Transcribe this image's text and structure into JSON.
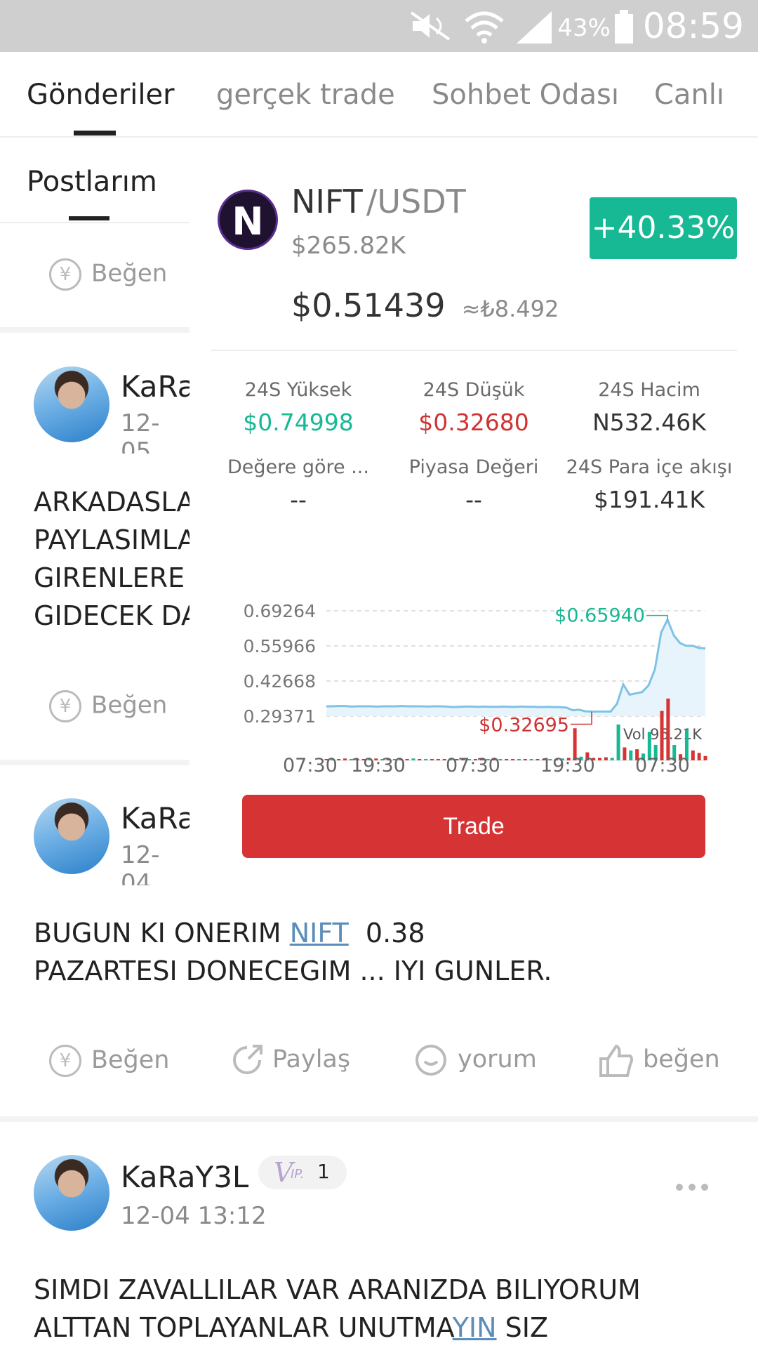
{
  "status_bar": {
    "battery": "43%",
    "time": "08:59"
  },
  "tabs": [
    {
      "label": "Gönderiler"
    },
    {
      "label": "gerçek trade"
    },
    {
      "label": "Sohbet Odası"
    },
    {
      "label": "Canlı"
    }
  ],
  "feed": {
    "sub_tab": "Postlarım",
    "like_label": "Beğen",
    "posts": [
      {
        "user": "KaRa",
        "date": "12-05",
        "text_lines": [
          "ARKADASLA",
          "PAYLASIMLA",
          "GIRENLERE",
          "GIDECEK DA"
        ]
      },
      {
        "user": "KaRa",
        "date": "12-04",
        "text_pre": "BUGUN KI ONERIM ",
        "text_link": "NIFT",
        "text_post": "  0.38",
        "text_line2": "PAZARTESI DONECEGIM ... IYI GUNLER."
      },
      {
        "user": "KaRaY3L",
        "vip_label": "IP.",
        "vip_level": "1",
        "date": "12-04 13:12",
        "line1": "SIMDI ZAVALLILAR VAR ARANIZDA BILIYORUM",
        "line2_pre": "ALTTAN TOPLAYANLAR UNUTMA",
        "line2_link": "YIN",
        "line2_post": " SIZ"
      }
    ],
    "actions": {
      "begen": "Beğen",
      "paylas": "Paylaş",
      "yorum": "yorum",
      "begen2": "beğen"
    }
  },
  "card": {
    "logo_letter": "N",
    "base": "NIFT",
    "quote": "/USDT",
    "volume": "$265.82K",
    "change": "+40.33%",
    "price": "$0.51439",
    "approx": "≈₺8.492",
    "stats": [
      {
        "label": "24S Yüksek",
        "value": "$0.74998",
        "tone": "green"
      },
      {
        "label": "24S Düşük",
        "value": "$0.32680",
        "tone": "red"
      },
      {
        "label": "24S Hacim",
        "value": "N532.46K",
        "tone": ""
      },
      {
        "label": "Değere göre ...",
        "value": "--",
        "tone": ""
      },
      {
        "label": "Piyasa Değeri",
        "value": "--",
        "tone": ""
      },
      {
        "label": "24S Para içe akışı",
        "value": "$191.41K",
        "tone": ""
      }
    ],
    "trade_label": "Trade"
  },
  "chart_data": {
    "type": "line",
    "title": "",
    "y_ticks": [
      "0.69264",
      "0.55966",
      "0.42668",
      "0.29371"
    ],
    "x_ticks": [
      "07:30",
      "19:30",
      "07:30",
      "19:30",
      "07:30"
    ],
    "ylim": [
      0.29371,
      0.69264
    ],
    "high_label": "$0.65940",
    "low_label": "$0.32695",
    "vol_label": "Vol 96.21K",
    "grid": true,
    "series": [
      {
        "values": [
          0.331,
          0.331,
          0.332,
          0.332,
          0.33,
          0.331,
          0.331,
          0.331,
          0.33,
          0.331,
          0.331,
          0.331,
          0.332,
          0.331,
          0.331,
          0.331,
          0.33,
          0.331,
          0.331,
          0.33,
          0.328,
          0.329,
          0.33,
          0.33,
          0.329,
          0.33,
          0.329,
          0.329,
          0.33,
          0.329,
          0.329,
          0.33,
          0.329,
          0.329,
          0.328,
          0.329,
          0.328,
          0.328,
          0.326,
          0.316,
          0.318,
          0.312,
          0.311,
          0.311,
          0.311,
          0.311,
          0.34,
          0.414,
          0.375,
          0.38,
          0.385,
          0.41,
          0.47,
          0.61,
          0.659,
          0.6,
          0.57,
          0.56,
          0.56,
          0.552,
          0.55
        ]
      }
    ],
    "volume": [
      0.02,
      0.02,
      0.02,
      0.03,
      0.02,
      0.02,
      0.02,
      0.02,
      0.03,
      0.02,
      0.02,
      0.02,
      0.02,
      0.02,
      0.03,
      0.02,
      0.02,
      0.02,
      0.02,
      0.02,
      0.03,
      0.02,
      0.02,
      0.02,
      0.02,
      0.02,
      0.02,
      0.02,
      0.02,
      0.02,
      0.02,
      0.02,
      0.02,
      0.02,
      0.02,
      0.02,
      0.02,
      0.02,
      0.03,
      0.04,
      0.52,
      0.06,
      0.13,
      0.04,
      0.04,
      0.05,
      0.04,
      0.58,
      0.21,
      0.16,
      0.18,
      0.11,
      0.46,
      0.25,
      0.8,
      1.0,
      0.25,
      0.1,
      0.5,
      0.16,
      0.12,
      0.07
    ],
    "volume_colors": [
      "r",
      "g",
      "r",
      "r",
      "g",
      "r",
      "r",
      "g",
      "r",
      "g",
      "r",
      "g",
      "r",
      "r",
      "g",
      "r",
      "g",
      "r",
      "r",
      "r",
      "g",
      "r",
      "r",
      "g",
      "r",
      "r",
      "g",
      "r",
      "g",
      "r",
      "r",
      "g",
      "r",
      "g",
      "r",
      "r",
      "g",
      "r",
      "g",
      "r",
      "r",
      "g",
      "r",
      "r",
      "r",
      "r",
      "g",
      "g",
      "r",
      "g",
      "r",
      "g",
      "g",
      "g",
      "r",
      "r",
      "g",
      "r",
      "g",
      "r",
      "r",
      "r"
    ]
  }
}
